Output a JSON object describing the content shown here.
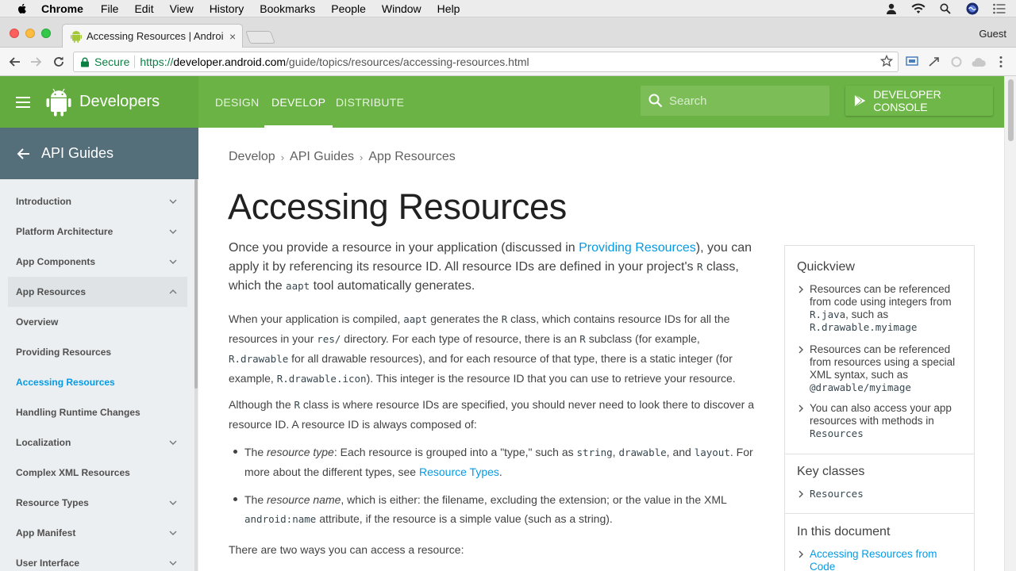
{
  "menubar": {
    "app_name": "Chrome",
    "items": [
      "File",
      "Edit",
      "View",
      "History",
      "Bookmarks",
      "People",
      "Window",
      "Help"
    ]
  },
  "tab": {
    "title": "Accessing Resources | Androi",
    "close": "×"
  },
  "profile": "Guest",
  "omnibox": {
    "secure_label": "Secure",
    "url_scheme": "https://",
    "url_host": "developer.android.com",
    "url_path": "/guide/topics/resources/accessing-resources.html"
  },
  "site": {
    "brand": "Developers",
    "nav": [
      "DESIGN",
      "DEVELOP",
      "DISTRIBUTE"
    ],
    "search_placeholder": "Search",
    "console_button": "DEVELOPER CONSOLE",
    "brand_color": "#6ab344"
  },
  "sidebar": {
    "title": "API Guides",
    "items": [
      {
        "label": "Introduction"
      },
      {
        "label": "Platform Architecture"
      },
      {
        "label": "App Components"
      },
      {
        "label": "App Resources"
      },
      {
        "label": "Overview"
      },
      {
        "label": "Providing Resources"
      },
      {
        "label": "Accessing Resources"
      },
      {
        "label": "Handling Runtime Changes"
      },
      {
        "label": "Localization"
      },
      {
        "label": "Complex XML Resources"
      },
      {
        "label": "Resource Types"
      },
      {
        "label": "App Manifest"
      },
      {
        "label": "User Interface"
      }
    ]
  },
  "main": {
    "breadcrumb": [
      "Develop",
      "API Guides",
      "App Resources"
    ],
    "title": "Accessing Resources",
    "intro": {
      "t1": "Once you provide a resource in your application (discussed in ",
      "link1": "Providing Resources",
      "t2": "), you can apply it by referencing its resource ID. All resource IDs are defined in your project's ",
      "code1": "R",
      "t3": " class, which the ",
      "code2": "aapt",
      "t4": " tool automatically generates."
    },
    "para1": {
      "t1": "When your application is compiled, ",
      "code1": "aapt",
      "t2": " generates the ",
      "code2": "R",
      "t3": " class, which contains resource IDs for all the resources in your ",
      "code3": "res/",
      "t4": " directory. For each type of resource, there is an ",
      "code4": "R",
      "t5": " subclass (for example, ",
      "code5": "R.drawable",
      "t6": " for all drawable resources), and for each resource of that type, there is a static integer (for example, ",
      "code6": "R.drawable.icon",
      "t7": "). This integer is the resource ID that you can use to retrieve your resource."
    },
    "para2": {
      "t1": "Although the ",
      "code1": "R",
      "t2": " class is where resource IDs are specified, you should never need to look there to discover a resource ID. A resource ID is always composed of:"
    },
    "bullet1": {
      "t1": "The ",
      "em1": "resource type",
      "t2": ": Each resource is grouped into a \"type,\" such as ",
      "code1": "string",
      "t3": ", ",
      "code2": "drawable",
      "t4": ", and ",
      "code3": "layout",
      "t5": ". For more about the different types, see ",
      "link1": "Resource Types",
      "t6": "."
    },
    "bullet2": {
      "t1": "The ",
      "em1": "resource name",
      "t2": ", which is either: the filename, excluding the extension; or the value in the XML ",
      "code1": "android:name",
      "t3": " attribute, if the resource is a simple value (such as a string)."
    },
    "para3": "There are two ways you can access a resource:"
  },
  "quickview": {
    "title": "Quickview",
    "items": [
      {
        "text": "Resources can be referenced from code using integers from ",
        "code": "R.java",
        "text2": ", such as ",
        "code2": "R.drawable.myimage"
      },
      {
        "text": "Resources can be referenced from resources using a special XML syntax, such as ",
        "code": "@drawable/myimage"
      },
      {
        "text": "You can also access your app resources with methods in ",
        "code": "Resources"
      }
    ],
    "key_classes_title": "Key classes",
    "key_classes": [
      "Resources"
    ],
    "in_doc_title": "In this document",
    "in_doc": [
      "Accessing Resources from Code"
    ]
  }
}
